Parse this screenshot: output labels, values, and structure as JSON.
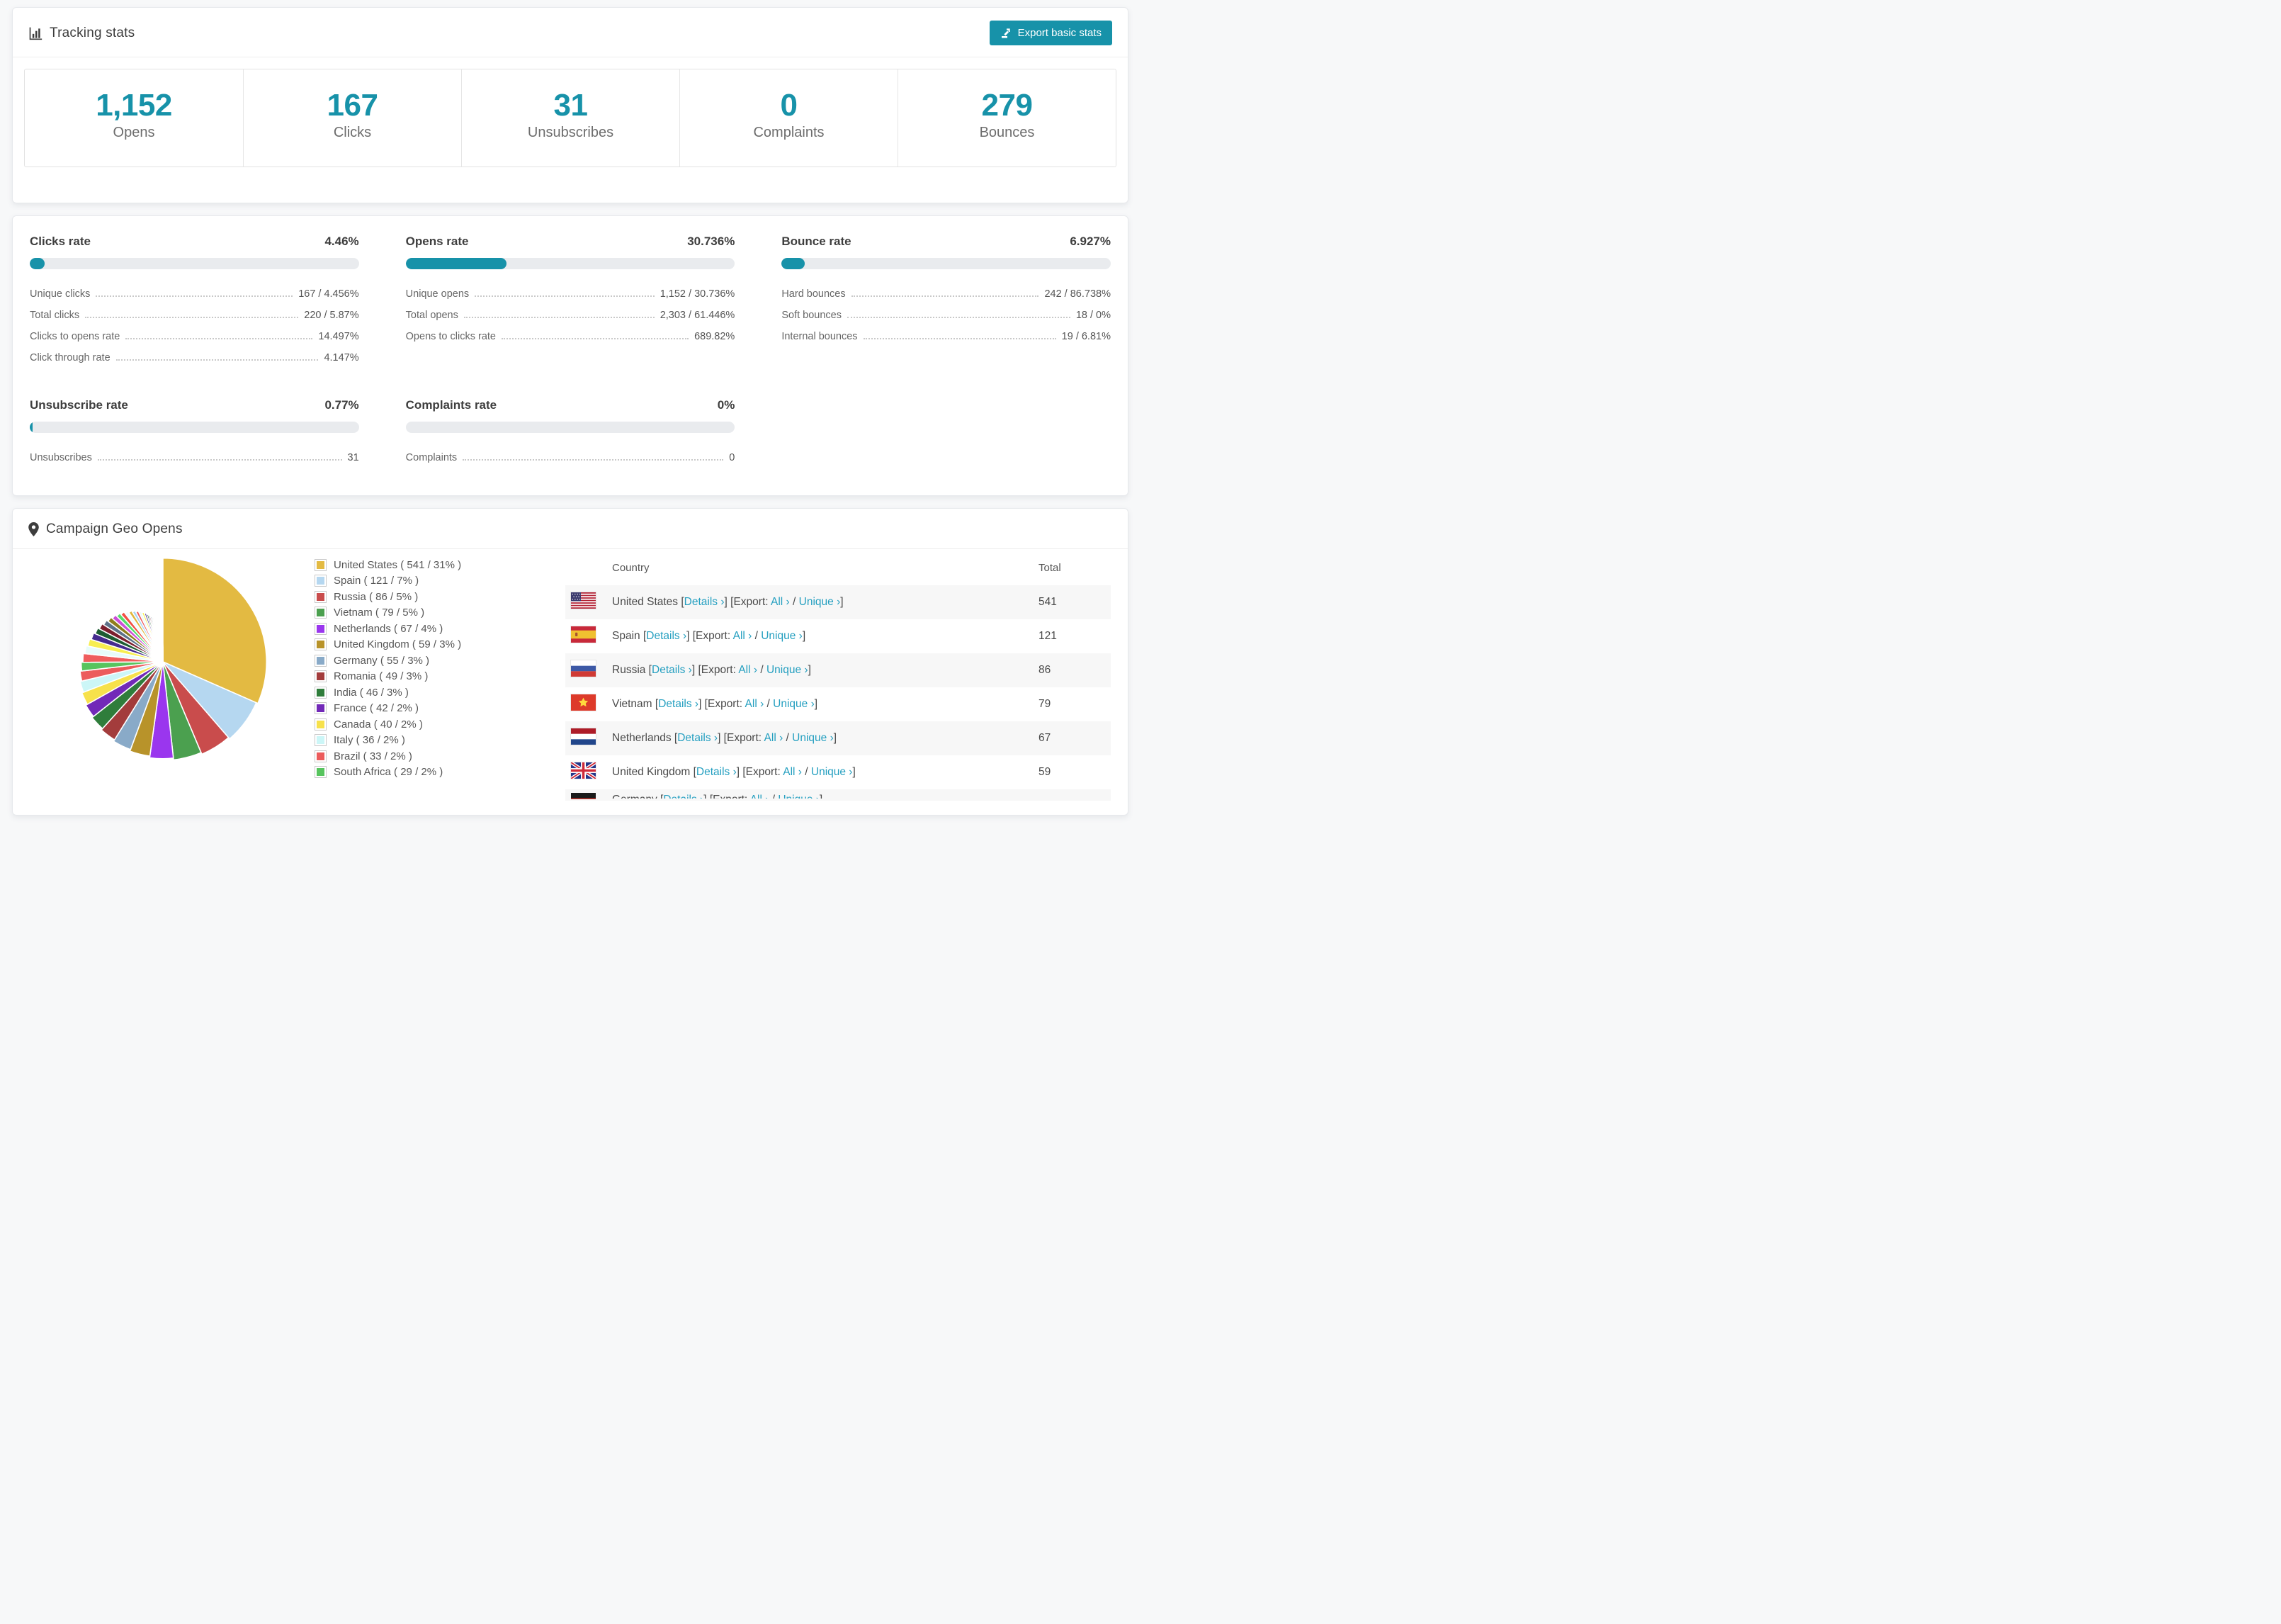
{
  "page": {
    "background": "#f7f8f9",
    "accent": "#1792a9",
    "link_color": "#249fc0"
  },
  "tracking": {
    "title": "Tracking stats",
    "export_button": "Export basic stats",
    "stats": [
      {
        "value": "1,152",
        "label": "Opens"
      },
      {
        "value": "167",
        "label": "Clicks"
      },
      {
        "value": "31",
        "label": "Unsubscribes"
      },
      {
        "value": "0",
        "label": "Complaints"
      },
      {
        "value": "279",
        "label": "Bounces"
      }
    ]
  },
  "rates": {
    "blocks": [
      {
        "key": "clicks",
        "title": "Clicks rate",
        "value": "4.46%",
        "bar_pct": 4.46,
        "metrics": [
          {
            "label": "Unique clicks",
            "value": "167 / 4.456%"
          },
          {
            "label": "Total clicks",
            "value": "220 / 5.87%"
          },
          {
            "label": "Clicks to opens rate",
            "value": "14.497%"
          },
          {
            "label": "Click through rate",
            "value": "4.147%"
          }
        ]
      },
      {
        "key": "opens",
        "title": "Opens rate",
        "value": "30.736%",
        "bar_pct": 30.736,
        "metrics": [
          {
            "label": "Unique opens",
            "value": "1,152 / 30.736%"
          },
          {
            "label": "Total opens",
            "value": "2,303 / 61.446%"
          },
          {
            "label": "Opens to clicks rate",
            "value": "689.82%"
          }
        ]
      },
      {
        "key": "bounce",
        "title": "Bounce rate",
        "value": "6.927%",
        "bar_pct": 6.927,
        "metrics": [
          {
            "label": "Hard bounces",
            "value": "242 / 86.738%"
          },
          {
            "label": "Soft bounces",
            "value": "18 / 0%"
          },
          {
            "label": "Internal bounces",
            "value": "19 / 6.81%"
          }
        ]
      },
      {
        "key": "unsubscribe",
        "title": "Unsubscribe rate",
        "value": "0.77%",
        "bar_pct": 0.77,
        "metrics": [
          {
            "label": "Unsubscribes",
            "value": "31"
          }
        ]
      },
      {
        "key": "complaints",
        "title": "Complaints rate",
        "value": "0%",
        "bar_pct": 0,
        "metrics": [
          {
            "label": "Complaints",
            "value": "0"
          }
        ]
      }
    ]
  },
  "geo": {
    "title": "Campaign Geo Opens",
    "chart_data": {
      "type": "pie",
      "title": "Campaign Geo Opens",
      "legend_position": "right",
      "start_angle_deg": -90,
      "direction": "clockwise",
      "slices": [
        {
          "name": "United States",
          "flag": "us",
          "value": 541,
          "pct": 31,
          "color": "#e3ba42"
        },
        {
          "name": "Spain",
          "flag": "es",
          "value": 121,
          "pct": 7,
          "color": "#b5d7f0"
        },
        {
          "name": "Russia",
          "flag": "ru",
          "value": 86,
          "pct": 5,
          "color": "#c94c4c"
        },
        {
          "name": "Vietnam",
          "flag": "vn",
          "value": 79,
          "pct": 5,
          "color": "#4ba04f"
        },
        {
          "name": "Netherlands",
          "flag": "nl",
          "value": 67,
          "pct": 4,
          "color": "#9a36ee"
        },
        {
          "name": "United Kingdom",
          "flag": "gb",
          "value": 59,
          "pct": 3,
          "color": "#b8932a"
        },
        {
          "name": "Germany",
          "flag": "de",
          "value": 55,
          "pct": 3,
          "color": "#89aac8"
        },
        {
          "name": "Romania",
          "flag": "ro",
          "value": 49,
          "pct": 3,
          "color": "#a33c3c"
        },
        {
          "name": "India",
          "flag": "in",
          "value": 46,
          "pct": 3,
          "color": "#2f7d3b"
        },
        {
          "name": "France",
          "flag": "fr",
          "value": 42,
          "pct": 2,
          "color": "#7229b8"
        },
        {
          "name": "Canada",
          "flag": "ca",
          "value": 40,
          "pct": 2,
          "color": "#f7e14b"
        },
        {
          "name": "Italy",
          "flag": "it",
          "value": 36,
          "pct": 2,
          "color": "#ccf6f7"
        },
        {
          "name": "Brazil",
          "flag": "br",
          "value": 33,
          "pct": 2,
          "color": "#ec5c5c"
        },
        {
          "name": "South Africa",
          "flag": "za",
          "value": 29,
          "pct": 2,
          "color": "#57c45e"
        }
      ],
      "other_slices_estimated": {
        "values": [
          30,
          28,
          26,
          25,
          23,
          22,
          21,
          20,
          19,
          18,
          17,
          16,
          15,
          14,
          13,
          12,
          11,
          10,
          9,
          8,
          8,
          7,
          7,
          6,
          6,
          5,
          5,
          4,
          4,
          3,
          3,
          3,
          2,
          2,
          2,
          2,
          1,
          1,
          1,
          1
        ],
        "palette": [
          "#ef5d5d",
          "#e7fbfa",
          "#f7ee4f",
          "#462b8f",
          "#1d5c31",
          "#7c1f2d",
          "#5d7188",
          "#8f7d1c",
          "#cb4fd8",
          "#57dd6c",
          "#f25044",
          "#eefcff",
          "#e0b63e",
          "#a8d4f2"
        ]
      }
    },
    "legend_format": {
      "open": "( ",
      "sep": " / ",
      "close": "% )"
    },
    "table": {
      "headers": [
        "Country",
        "Total"
      ],
      "link_labels": {
        "details": "Details",
        "export": "Export:",
        "all": "All",
        "unique": "Unique",
        "chevron": "›"
      },
      "rows": [
        {
          "flag": "us",
          "name": "United States",
          "total": "541"
        },
        {
          "flag": "es",
          "name": "Spain",
          "total": "121"
        },
        {
          "flag": "ru",
          "name": "Russia",
          "total": "86"
        },
        {
          "flag": "vn",
          "name": "Vietnam",
          "total": "79"
        },
        {
          "flag": "nl",
          "name": "Netherlands",
          "total": "67"
        },
        {
          "flag": "gb",
          "name": "United Kingdom",
          "total": "59"
        },
        {
          "flag": "de",
          "name": "Germany",
          "total": "",
          "partial": true
        }
      ]
    }
  }
}
